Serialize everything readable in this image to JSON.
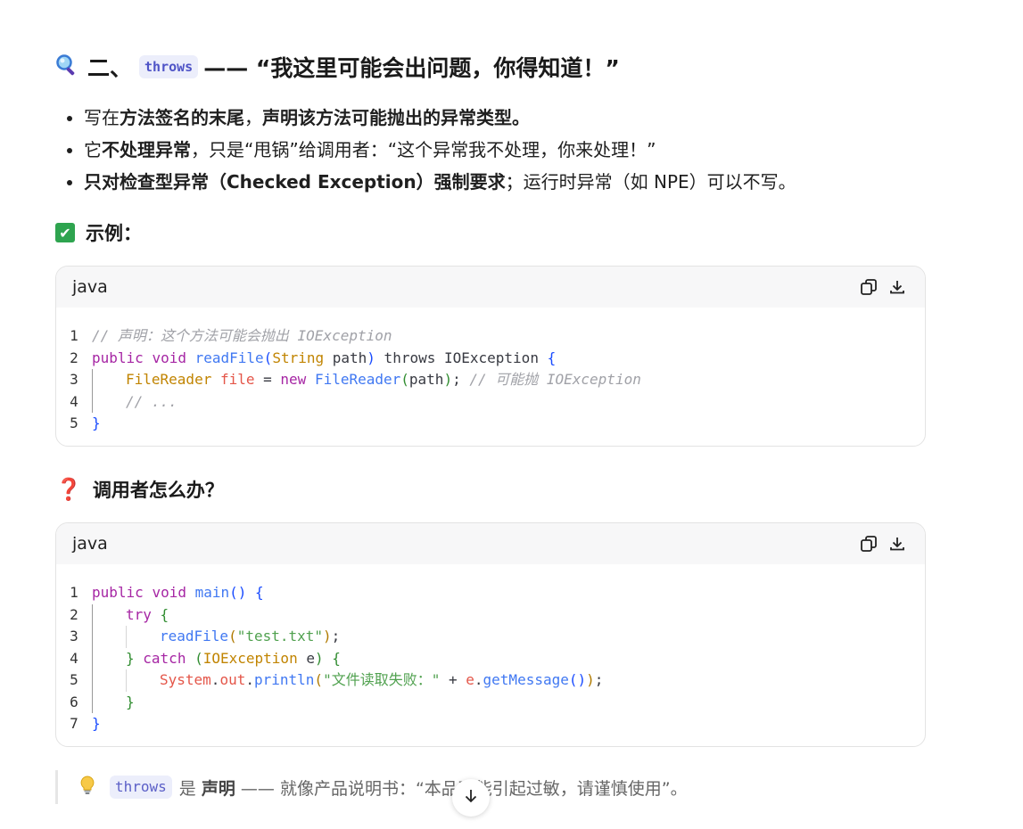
{
  "section": {
    "icon": "magnifier-icon",
    "title_prefix": "二、",
    "title_code": "throws",
    "title_suffix": "—— “我这里可能会出问题，你得知道！”"
  },
  "bullets": [
    {
      "pre": "写在",
      "bold": "方法签名的末尾",
      "post": "，",
      "bold2": "声明该方法可能抛出的异常类型。",
      "post2": ""
    },
    {
      "pre": "它",
      "bold": "不处理异常",
      "post": "，只是“甩锅”给调用者：“这个异常我不处理，你来处理！”",
      "bold2": "",
      "post2": ""
    },
    {
      "pre": "",
      "bold": "只对检查型异常（Checked Exception）强制要求",
      "post": "；运行时异常（如 NPE）可以不写。",
      "bold2": "",
      "post2": ""
    }
  ],
  "example_heading": {
    "icon": "check-mark-icon",
    "label": "示例："
  },
  "caller_heading": {
    "icon": "question-mark-icon",
    "label": "调用者怎么办？"
  },
  "code_blocks": [
    {
      "language": "java",
      "line_numbers": [
        "1",
        "2",
        "3",
        "4",
        "5"
      ]
    },
    {
      "language": "java",
      "line_numbers": [
        "1",
        "2",
        "3",
        "4",
        "5",
        "6",
        "7"
      ]
    }
  ],
  "code1": {
    "l1": "// 声明：这个方法可能会抛出 IOException",
    "l2_kw1": "public",
    "l2_kw2": "void",
    "l2_fn": "readFile",
    "l2_ty": "String",
    "l2_param": " path",
    "l2_throws": " throws ",
    "l2_ex": "IOException ",
    "l3_ty": "FileReader",
    "l3_var": " file",
    "l3_eq": " = ",
    "l3_new": "new ",
    "l3_fn": "FileReader",
    "l3_arg": "path",
    "l3_semi": "; ",
    "l3_cm": "// 可能抛 IOException",
    "l4": "// ..."
  },
  "code2": {
    "l1_kw1": "public",
    "l1_kw2": "void",
    "l1_fn": "main",
    "l2_kw": "try",
    "l3_fn": "readFile",
    "l3_str": "\"test.txt\"",
    "l4_kw": "catch",
    "l4_ty": "IOException",
    "l4_var": " e",
    "l5_obj": "System",
    "l5_out": "out",
    "l5_fn": "println",
    "l5_str": "\"文件读取失败：\"",
    "l5_plus": " + ",
    "l5_e": "e",
    "l5_fn2": "getMessage"
  },
  "tip": {
    "icon": "lightbulb-icon",
    "code": "throws",
    "mid": "是",
    "bold": "声明",
    "text": "—— 就像产品说明书：“本品可能引起过敏，请谨慎使用”。"
  },
  "controls": {
    "copy_icon": "copy-icon",
    "download_icon": "download-icon",
    "scroll_icon": "arrow-down-icon"
  }
}
